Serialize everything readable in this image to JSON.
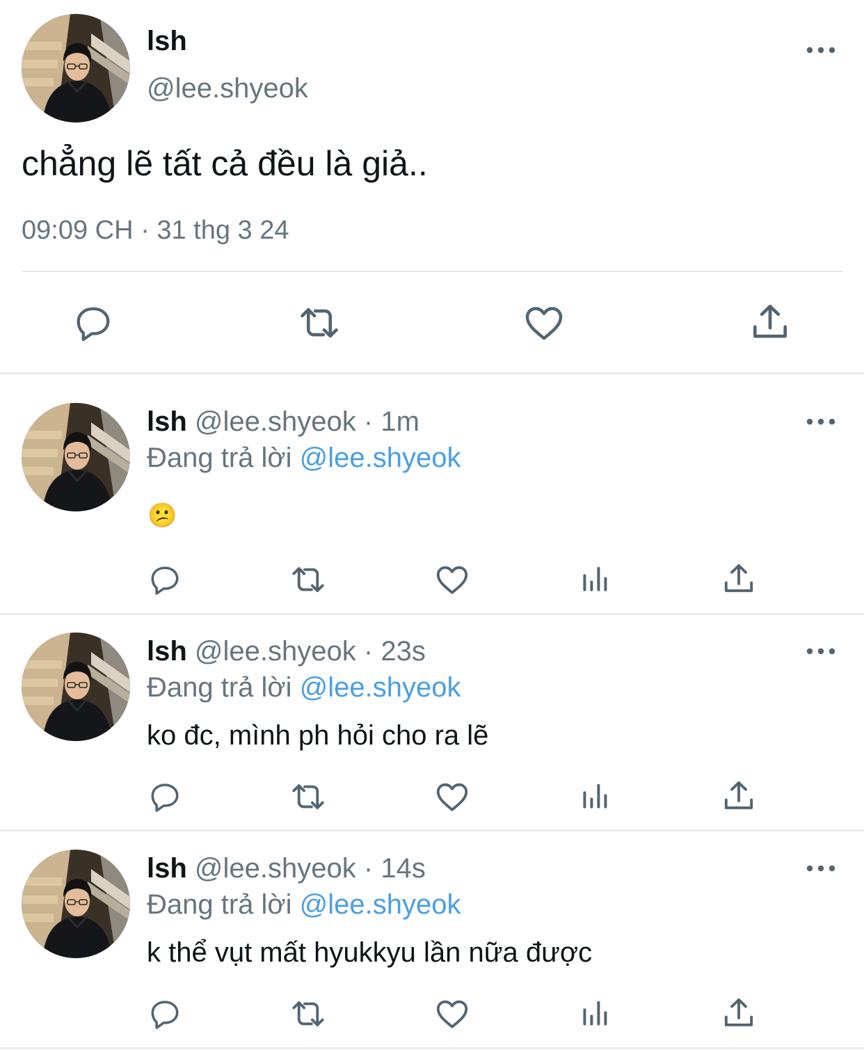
{
  "main_tweet": {
    "display_name": "lsh",
    "handle": "@lee.shyeok",
    "text": "chẳng lẽ tất cả đều là giả..",
    "time": "09:09 CH",
    "separator": "·",
    "date": "31 thg 3 24",
    "avatar_icon": "profile-photo",
    "more_icon": "more-dots-icon",
    "actions": [
      "reply-icon",
      "retweet-icon",
      "like-icon",
      "share-icon"
    ]
  },
  "replies": [
    {
      "display_name": "lsh",
      "handle": "@lee.shyeok",
      "separator": "·",
      "time": "1m",
      "replying_prefix": "Đang trả lời",
      "replying_to": "@lee.shyeok",
      "text": "",
      "emoji": "😕"
    },
    {
      "display_name": "lsh",
      "handle": "@lee.shyeok",
      "separator": "·",
      "time": "23s",
      "replying_prefix": "Đang trả lời",
      "replying_to": "@lee.shyeok",
      "text": "ko đc, mình ph hỏi cho ra lẽ",
      "emoji": ""
    },
    {
      "display_name": "lsh",
      "handle": "@lee.shyeok",
      "separator": "·",
      "time": "14s",
      "replying_prefix": "Đang trả lời",
      "replying_to": "@lee.shyeok",
      "text": "k thể vụt mất hyukkyu lần nữa được",
      "emoji": ""
    }
  ],
  "reply_actions": [
    "reply-icon",
    "retweet-icon",
    "like-icon",
    "analytics-icon",
    "share-icon"
  ],
  "colors": {
    "text": "#0f1419",
    "secondary": "#66757f",
    "link": "#4a9ee3",
    "divider": "#e9ecef",
    "icon": "#536471"
  }
}
